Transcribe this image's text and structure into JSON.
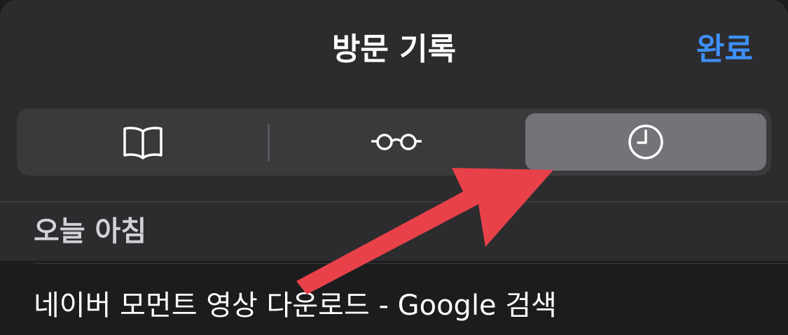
{
  "header": {
    "title": "방문 기록",
    "done_label": "완료"
  },
  "segments": [
    {
      "icon": "book-icon",
      "selected": false
    },
    {
      "icon": "glasses-icon",
      "selected": false
    },
    {
      "icon": "clock-icon",
      "selected": true
    }
  ],
  "section": {
    "label": "오늘 아침"
  },
  "history": [
    {
      "title": "네이버 모먼트 영상 다운로드 - Google 검색"
    }
  ],
  "colors": {
    "accent": "#3e8ff7",
    "annotation_arrow": "#e8414a",
    "background": "#1c1c1e",
    "sheet": "#2c2c2e"
  }
}
